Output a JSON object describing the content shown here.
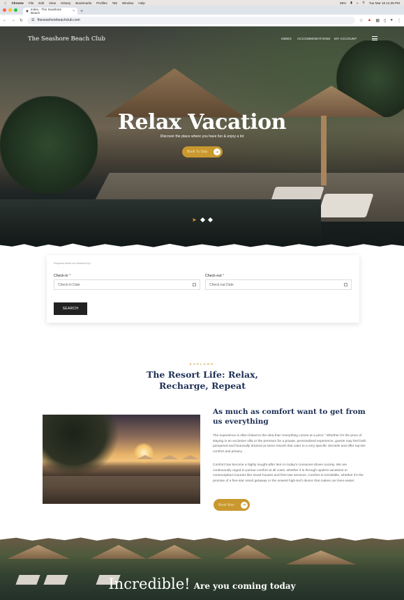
{
  "os": {
    "app": "Chrome",
    "menus": [
      "File",
      "Edit",
      "View",
      "History",
      "Bookmarks",
      "Profiles",
      "Tab",
      "Window",
      "Help"
    ],
    "clock": "Tue Mar 18  12:26 PM",
    "battery": "58%"
  },
  "browser": {
    "tab_title": "Index - The Seashore Beach",
    "url": "theseashorebeachclub.com"
  },
  "site": {
    "name": "The Seashore Beach Club",
    "nav": [
      "INDEX",
      "ACCOMMODATIONS",
      "MY ACCOUNT"
    ]
  },
  "hero": {
    "title": "Relax Vacation",
    "subtitle": "Discover the place where you have fun & enjoy a lot",
    "button": "Book To Stay"
  },
  "booking": {
    "required_note": "Required fields are followed by *",
    "checkin_label": "Check-in",
    "checkin_placeholder": "Check-in Date",
    "checkout_label": "Check-out",
    "checkout_placeholder": "Check-out Date",
    "required_mark": "*",
    "search": "SEARCH"
  },
  "resort": {
    "eyebrow": "EXPLORE",
    "title": "The Resort Life: Relax, Recharge, Repeat",
    "content_title": "As much as comfort want to get from us everything",
    "para1": "The experience is often linked to the idea that \"everything comes at a price.\" Whether it's the price of staying in an exclusive villa or the premium for a private, personalized experience, guests may feel both pampered and financially drained at some resorts that cater to a very specific clientele and offer top-tier comfort and privacy.",
    "para2": "Comfort has become a highly sought-after item in today's consumer-driven society. We are continuously urged to pursue comfort at all costs, whether it is through opulent vacations or commonplace luxuries like smart houses and first-rate services. Comfort is irresistible, whether it's the promise of a five-star resort getaway or the newest high-tech device that makes our lives easier.",
    "button": "Book Now"
  },
  "bottom": {
    "big": "Incredible!",
    "small": "Are you coming today"
  }
}
